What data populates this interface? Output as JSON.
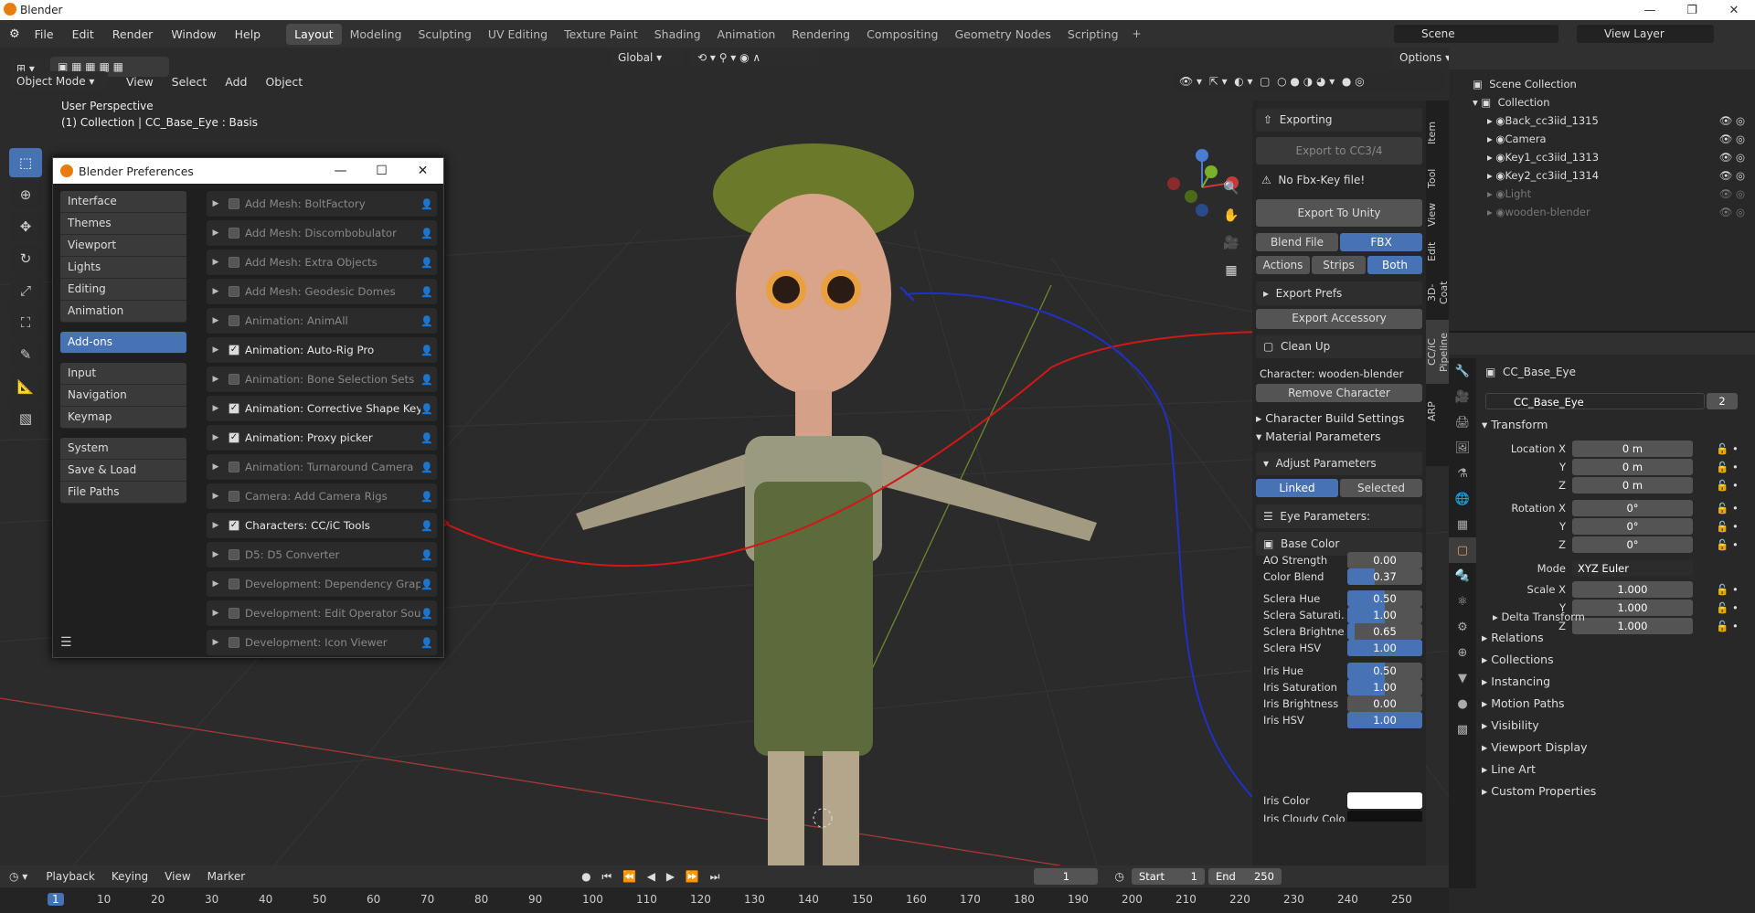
{
  "window": {
    "title": "Blender"
  },
  "menu": [
    "File",
    "Edit",
    "Render",
    "Window",
    "Help"
  ],
  "workspace_tabs": [
    {
      "label": "Layout",
      "active": true
    },
    {
      "label": "Modeling"
    },
    {
      "label": "Sculpting"
    },
    {
      "label": "UV Editing"
    },
    {
      "label": "Texture Paint"
    },
    {
      "label": "Shading"
    },
    {
      "label": "Animation"
    },
    {
      "label": "Rendering"
    },
    {
      "label": "Compositing"
    },
    {
      "label": "Geometry Nodes"
    },
    {
      "label": "Scripting"
    }
  ],
  "scene": {
    "label": "Scene"
  },
  "view_layer": {
    "label": "View Layer"
  },
  "viewport": {
    "mode": "Object Mode",
    "menus": [
      "View",
      "Select",
      "Add",
      "Object"
    ],
    "transform": "Global",
    "options": "Options",
    "perspective": "User Perspective",
    "collection_info": "(1) Collection | CC_Base_Eye : Basis"
  },
  "prefs": {
    "title": "Blender Preferences",
    "nav_groups": [
      [
        "Interface",
        "Themes",
        "Viewport",
        "Lights",
        "Editing",
        "Animation"
      ],
      [
        "Add-ons"
      ],
      [
        "Input",
        "Navigation",
        "Keymap"
      ],
      [
        "System",
        "Save & Load",
        "File Paths"
      ]
    ],
    "active_nav": "Add-ons",
    "addons": [
      {
        "name": "Add Mesh: BoltFactory",
        "enabled": false
      },
      {
        "name": "Add Mesh: Discombobulator",
        "enabled": false
      },
      {
        "name": "Add Mesh: Extra Objects",
        "enabled": false
      },
      {
        "name": "Add Mesh: Geodesic Domes",
        "enabled": false
      },
      {
        "name": "Animation: AnimAll",
        "enabled": false
      },
      {
        "name": "Animation: Auto-Rig Pro",
        "enabled": true
      },
      {
        "name": "Animation: Bone Selection Sets",
        "enabled": false
      },
      {
        "name": "Animation: Corrective Shape Keys",
        "enabled": true
      },
      {
        "name": "Animation: Proxy picker",
        "enabled": true
      },
      {
        "name": "Animation: Turnaround Camera",
        "enabled": false
      },
      {
        "name": "Camera: Add Camera Rigs",
        "enabled": false
      },
      {
        "name": "Characters: CC/iC Tools",
        "enabled": true
      },
      {
        "name": "D5: D5 Converter",
        "enabled": false
      },
      {
        "name": "Development: Dependency Grap...",
        "enabled": false
      },
      {
        "name": "Development: Edit Operator Sour...",
        "enabled": false
      },
      {
        "name": "Development: Icon Viewer",
        "enabled": false
      }
    ]
  },
  "npanel": {
    "tabs": [
      "Item",
      "Tool",
      "View",
      "Edit",
      "3D-Coat",
      "CC/iC Pipeline",
      "ARP"
    ],
    "exporting": "Exporting",
    "export_cc3": "Export to CC3/4",
    "no_fbx": "No Fbx-Key file!",
    "export_unity": "Export To Unity",
    "blend_file": "Blend File",
    "fbx": "FBX",
    "actions": "Actions",
    "strips": "Strips",
    "both": "Both",
    "export_prefs": "Export Prefs",
    "export_accessory": "Export Accessory",
    "clean_up": "Clean Up",
    "character": "Character: wooden-blender",
    "remove_character": "Remove Character",
    "char_build": "Character Build Settings",
    "material_params": "Material Parameters",
    "adjust_params": "Adjust Parameters",
    "linked": "Linked",
    "selected": "Selected",
    "eye_params": "Eye Parameters:",
    "base_color": "Base Color",
    "params": [
      {
        "label": "AO Strength",
        "value": "0.00",
        "fill": 0.0
      },
      {
        "label": "Color Blend",
        "value": "0.37",
        "fill": 0.37
      },
      {
        "label": "Sclera Hue",
        "value": "0.50",
        "fill": 0.5
      },
      {
        "label": "Sclera Saturati...",
        "value": "1.00",
        "fill": 0.5
      },
      {
        "label": "Sclera Brightne...",
        "value": "0.65",
        "fill": 0.1
      },
      {
        "label": "Sclera HSV",
        "value": "1.00",
        "fill": 1.0
      },
      {
        "label": "Iris Hue",
        "value": "0.50",
        "fill": 0.5
      },
      {
        "label": "Iris Saturation",
        "value": "1.00",
        "fill": 0.5
      },
      {
        "label": "Iris Brightness",
        "value": "0.00",
        "fill": 0.0
      },
      {
        "label": "Iris HSV",
        "value": "1.00",
        "fill": 1.0
      }
    ],
    "iris_color": "Iris Color",
    "iris_cloudy": "Iris Cloudy Color"
  },
  "outliner": {
    "root": "Scene Collection",
    "collection": "Collection",
    "items": [
      {
        "name": "Back_cc3iid_1315",
        "dim": false
      },
      {
        "name": "Camera",
        "dim": false
      },
      {
        "name": "Key1_cc3iid_1313",
        "dim": false
      },
      {
        "name": "Key2_cc3iid_1314",
        "dim": false
      },
      {
        "name": "Light",
        "dim": true
      },
      {
        "name": "wooden-blender",
        "dim": true
      }
    ]
  },
  "properties": {
    "object_name": "CC_Base_Eye",
    "data_name": "CC_Base_Eye",
    "users": "2",
    "transform": "Transform",
    "location": [
      {
        "axis": "Location X",
        "value": "0 m"
      },
      {
        "axis": "Y",
        "value": "0 m"
      },
      {
        "axis": "Z",
        "value": "0 m"
      }
    ],
    "rotation": [
      {
        "axis": "Rotation X",
        "value": "0°"
      },
      {
        "axis": "Y",
        "value": "0°"
      },
      {
        "axis": "Z",
        "value": "0°"
      }
    ],
    "mode_label": "Mode",
    "mode_value": "XYZ Euler",
    "scale": [
      {
        "axis": "Scale X",
        "value": "1.000"
      },
      {
        "axis": "Y",
        "value": "1.000"
      },
      {
        "axis": "Z",
        "value": "1.000"
      }
    ],
    "delta": "Delta Transform",
    "sections": [
      "Relations",
      "Collections",
      "Instancing",
      "Motion Paths",
      "Visibility",
      "Viewport Display",
      "Line Art",
      "Custom Properties"
    ]
  },
  "timeline": {
    "menus": [
      "Playback",
      "Keying",
      "View",
      "Marker"
    ],
    "current": "1",
    "start_label": "Start",
    "start": "1",
    "end_label": "End",
    "end": "250",
    "ticks": [
      "1",
      "10",
      "20",
      "30",
      "40",
      "50",
      "60",
      "70",
      "80",
      "90",
      "100",
      "110",
      "120",
      "130",
      "140",
      "150",
      "160",
      "170",
      "180",
      "190",
      "200",
      "210",
      "220",
      "230",
      "240",
      "250"
    ]
  },
  "colors": {
    "accent": "#4772b3",
    "orange": "#e87d0d",
    "red_arrow": "#d01818",
    "blue_arrow": "#2030c8"
  }
}
